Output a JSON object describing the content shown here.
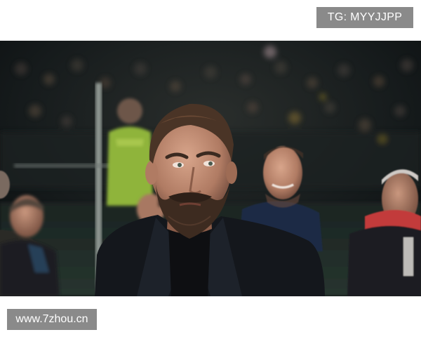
{
  "watermark_top": {
    "text": "TG: MYYJJPP"
  },
  "watermark_bottom": {
    "text": "www.7zhou.cn"
  },
  "photo": {
    "subject": "bearded-man-in-dark-jacket",
    "setting": "stadium-crowd-at-night"
  },
  "colors": {
    "badge_bg": "#8a8a8a",
    "badge_text": "#ffffff",
    "page_bg": "#ffffff"
  }
}
